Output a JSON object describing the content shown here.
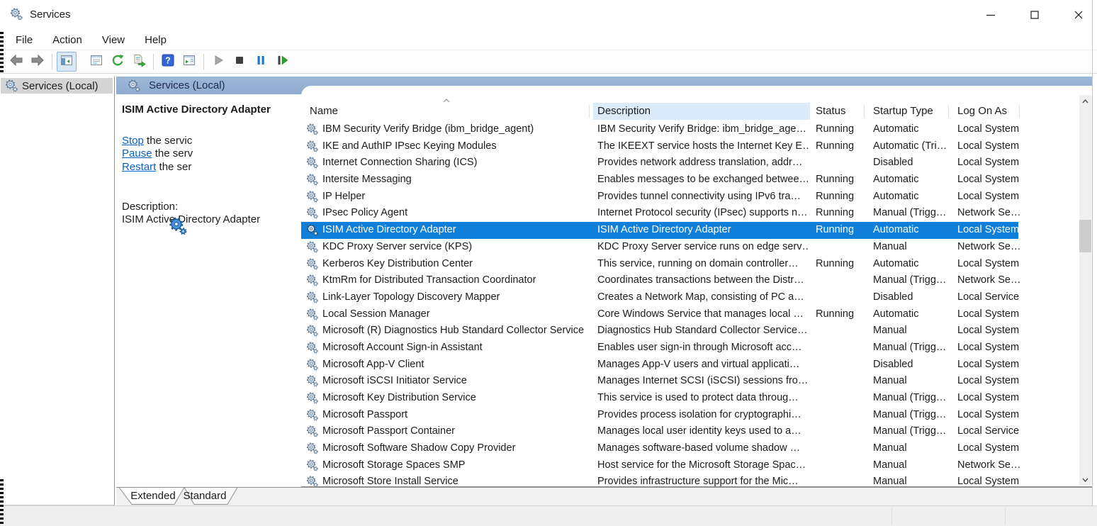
{
  "window": {
    "title": "Services"
  },
  "menu": {
    "items": [
      "File",
      "Action",
      "View",
      "Help"
    ]
  },
  "toolbar": {
    "buttons": [
      "back",
      "forward",
      "show-console-tree",
      "properties",
      "refresh",
      "export-list",
      "help",
      "show-action-pane",
      "start-service",
      "stop-service",
      "pause-service",
      "restart-service"
    ]
  },
  "tree": {
    "items": [
      {
        "label": "Services (Local)",
        "selected": true
      }
    ]
  },
  "panel": {
    "header": "Services (Local)",
    "service_title": "ISIM Active Directory Adapter",
    "actions": [
      {
        "link": "Stop",
        "rest": " the servic"
      },
      {
        "link": "Pause",
        "rest": " the serv"
      },
      {
        "link": "Restart",
        "rest": " the ser"
      }
    ],
    "description_label": "Description:",
    "description": "ISIM Active Directory Adapter"
  },
  "table": {
    "columns": [
      "Name",
      "Description",
      "Status",
      "Startup Type",
      "Log On As"
    ],
    "rows": [
      {
        "name": "IBM Security Verify Bridge (ibm_bridge_agent)",
        "desc": "IBM Security Verify Bridge: ibm_bridge_age…",
        "status": "Running",
        "startup": "Automatic",
        "logon": "Local System"
      },
      {
        "name": "IKE and AuthIP IPsec Keying Modules",
        "desc": "The IKEEXT service hosts the Internet Key E…",
        "status": "Running",
        "startup": "Automatic (Tri…",
        "logon": "Local System"
      },
      {
        "name": "Internet Connection Sharing (ICS)",
        "desc": "Provides network address translation, addr…",
        "status": "",
        "startup": "Disabled",
        "logon": "Local System"
      },
      {
        "name": "Intersite Messaging",
        "desc": "Enables messages to be exchanged betwee…",
        "status": "Running",
        "startup": "Automatic",
        "logon": "Local System"
      },
      {
        "name": "IP Helper",
        "desc": "Provides tunnel connectivity using IPv6 tra…",
        "status": "Running",
        "startup": "Automatic",
        "logon": "Local System"
      },
      {
        "name": "IPsec Policy Agent",
        "desc": "Internet Protocol security (IPsec) supports n…",
        "status": "Running",
        "startup": "Manual (Trigg…",
        "logon": "Network Se…"
      },
      {
        "name": "ISIM Active Directory Adapter",
        "desc": "ISIM Active Directory Adapter",
        "status": "Running",
        "startup": "Automatic",
        "logon": "Local System",
        "selected": true
      },
      {
        "name": "KDC Proxy Server service (KPS)",
        "desc": "KDC Proxy Server service runs on edge serv…",
        "status": "",
        "startup": "Manual",
        "logon": "Network Se…"
      },
      {
        "name": "Kerberos Key Distribution Center",
        "desc": "This service, running on domain controller…",
        "status": "Running",
        "startup": "Automatic",
        "logon": "Local System"
      },
      {
        "name": "KtmRm for Distributed Transaction Coordinator",
        "desc": "Coordinates transactions between the Distr…",
        "status": "",
        "startup": "Manual (Trigg…",
        "logon": "Network Se…"
      },
      {
        "name": "Link-Layer Topology Discovery Mapper",
        "desc": "Creates a Network Map, consisting of PC a…",
        "status": "",
        "startup": "Disabled",
        "logon": "Local Service"
      },
      {
        "name": "Local Session Manager",
        "desc": "Core Windows Service that manages local …",
        "status": "Running",
        "startup": "Automatic",
        "logon": "Local System"
      },
      {
        "name": "Microsoft (R) Diagnostics Hub Standard Collector Service",
        "desc": "Diagnostics Hub Standard Collector Service…",
        "status": "",
        "startup": "Manual",
        "logon": "Local System"
      },
      {
        "name": "Microsoft Account Sign-in Assistant",
        "desc": "Enables user sign-in through Microsoft acc…",
        "status": "",
        "startup": "Manual (Trigg…",
        "logon": "Local System"
      },
      {
        "name": "Microsoft App-V Client",
        "desc": "Manages App-V users and virtual applicati…",
        "status": "",
        "startup": "Disabled",
        "logon": "Local System"
      },
      {
        "name": "Microsoft iSCSI Initiator Service",
        "desc": "Manages Internet SCSI (iSCSI) sessions fro…",
        "status": "",
        "startup": "Manual",
        "logon": "Local System"
      },
      {
        "name": "Microsoft Key Distribution Service",
        "desc": "This service is used to protect data throug…",
        "status": "",
        "startup": "Manual (Trigg…",
        "logon": "Local System"
      },
      {
        "name": "Microsoft Passport",
        "desc": "Provides process isolation for cryptographi…",
        "status": "",
        "startup": "Manual (Trigg…",
        "logon": "Local System"
      },
      {
        "name": "Microsoft Passport Container",
        "desc": "Manages local user identity keys used to a…",
        "status": "",
        "startup": "Manual (Trigg…",
        "logon": "Local Service"
      },
      {
        "name": "Microsoft Software Shadow Copy Provider",
        "desc": "Manages software-based volume shadow …",
        "status": "",
        "startup": "Manual",
        "logon": "Local System"
      },
      {
        "name": "Microsoft Storage Spaces SMP",
        "desc": "Host service for the Microsoft Storage Spac…",
        "status": "",
        "startup": "Manual",
        "logon": "Network Se…"
      },
      {
        "name": "Microsoft Store Install Service",
        "desc": "Provides infrastructure support for the Mic…",
        "status": "",
        "startup": "Manual",
        "logon": "Local System"
      }
    ]
  },
  "tabs": {
    "items": [
      "Extended",
      "Standard"
    ],
    "active": "Extended"
  },
  "colors": {
    "selection": "#0f7fd9",
    "band_top": "#9db7d7",
    "band_bottom": "#8fabcf",
    "link": "#0a62c4",
    "header_hover": "#dcebf9"
  }
}
